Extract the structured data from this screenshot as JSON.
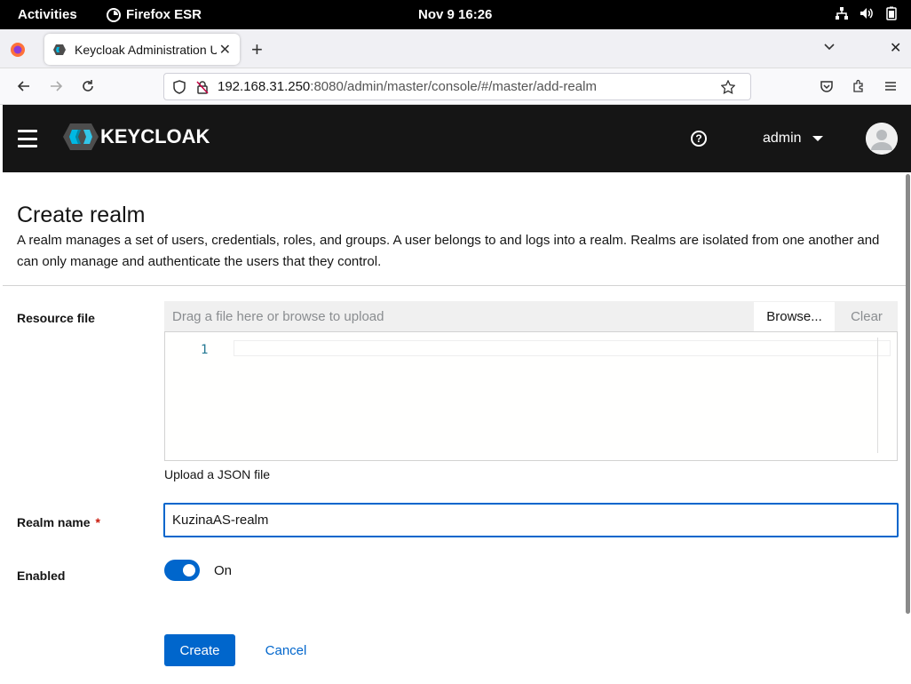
{
  "system_bar": {
    "activities": "Activities",
    "app_name": "Firefox ESR",
    "clock": "Nov 9  16:26"
  },
  "browser": {
    "tab_title": "Keycloak Administration U",
    "url_host": "192.168.31.250",
    "url_rest": ":8080/admin/master/console/#/master/add-realm"
  },
  "header": {
    "logo_text": "KEYCLOAK",
    "user": "admin"
  },
  "page": {
    "title": "Create realm",
    "description": "A realm manages a set of users, credentials, roles, and groups. A user belongs to and logs into a realm. Realms are isolated from one another and can only manage and authenticate the users that they control."
  },
  "form": {
    "resource_file_label": "Resource file",
    "file_placeholder": "Drag a file here or browse to upload",
    "browse_label": "Browse...",
    "clear_label": "Clear",
    "editor_line_number": "1",
    "helper_text": "Upload a JSON file",
    "realm_name_label": "Realm name",
    "required_mark": "*",
    "realm_name_value": "KuzinaAS-realm",
    "enabled_label": "Enabled",
    "enabled_state": "On",
    "create_label": "Create",
    "cancel_label": "Cancel"
  },
  "colors": {
    "primary": "#0066cc",
    "header_bg": "#151515",
    "required": "#c9190b"
  },
  "icons": [
    "firefox-icon",
    "network-icon",
    "volume-icon",
    "battery-icon",
    "keycloak-favicon",
    "back-icon",
    "forward-icon",
    "reload-icon",
    "shield-icon",
    "lock-icon",
    "star-icon",
    "pocket-icon",
    "extensions-icon",
    "menu-icon",
    "help-icon",
    "avatar-icon"
  ]
}
